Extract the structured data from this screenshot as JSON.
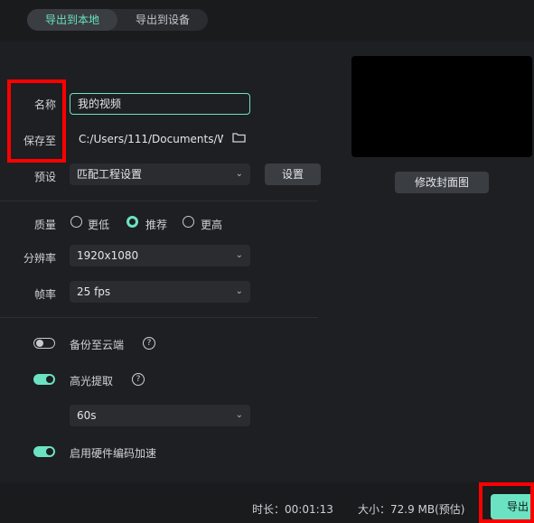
{
  "tabs": [
    {
      "label": "导出到本地",
      "active": true
    },
    {
      "label": "导出到设备",
      "active": false
    }
  ],
  "form": {
    "name_label": "名称",
    "name_value": "我的视频",
    "save_label": "保存至",
    "save_value": "C:/Users/111/Documents/W",
    "preset_label": "预设",
    "preset_value": "匹配工程设置",
    "settings_button": "设置",
    "quality_label": "质量",
    "quality_options": [
      "更低",
      "推荐",
      "更高"
    ],
    "quality_selected": "推荐",
    "resolution_label": "分辨率",
    "resolution_value": "1920x1080",
    "framerate_label": "帧率",
    "framerate_value": "25 fps",
    "cloud_backup_label": "备份至云端",
    "cloud_backup_on": false,
    "highlight_label": "高光提取",
    "highlight_on": true,
    "highlight_duration": "60s",
    "hw_accel_label": "启用硬件编码加速",
    "hw_accel_on": true
  },
  "preview": {
    "cover_button": "修改封面图"
  },
  "footer": {
    "duration": "时长：00:01:13",
    "size": "大小：72.9 MB(预估)",
    "export_button": "导出"
  },
  "colors": {
    "accent": "#6be3c2",
    "highlight_box": "#ff0000"
  }
}
